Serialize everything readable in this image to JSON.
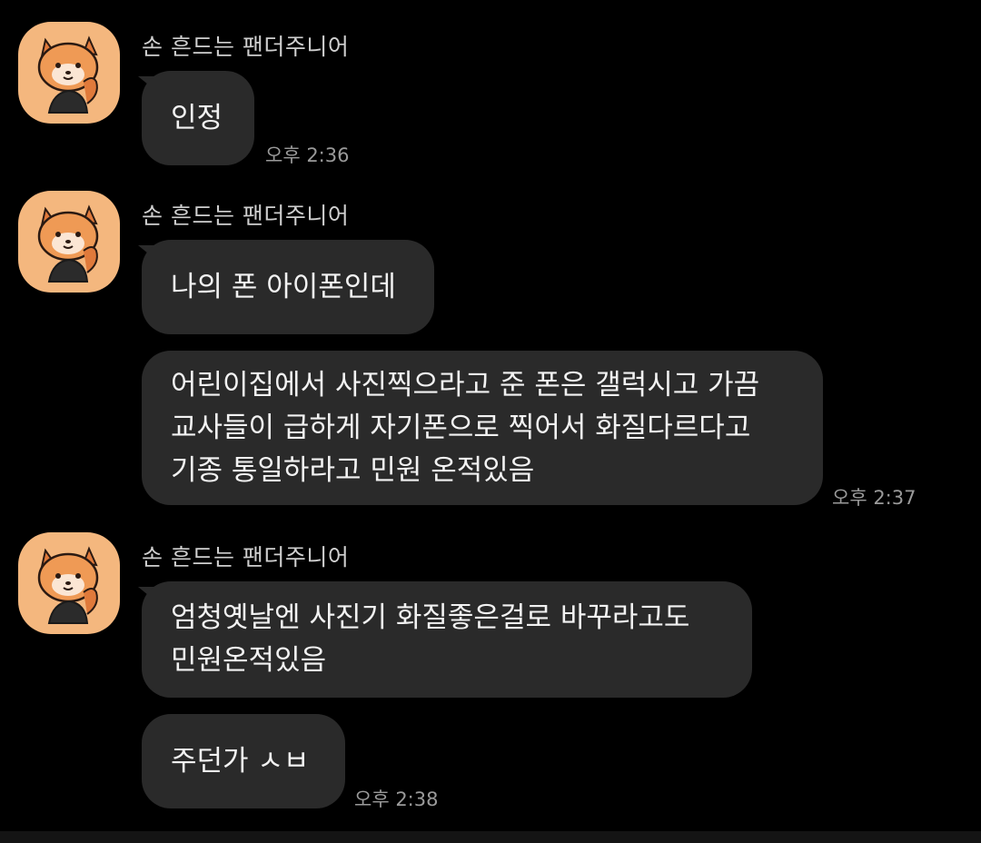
{
  "colors": {
    "background": "#000000",
    "bubble": "#2a2a2a",
    "text": "#f2f2f2",
    "sender": "#cfcfcf",
    "timestamp": "#9a9a9a",
    "avatar_bg": "#f4b77e"
  },
  "groups": [
    {
      "sender": "손 흔드는 팬더주니어",
      "avatar_icon": "red-panda-avatar-icon",
      "messages": [
        {
          "lines": [
            "인정"
          ],
          "time": "오후 2:36"
        }
      ]
    },
    {
      "sender": "손 흔드는 팬더주니어",
      "avatar_icon": "red-panda-avatar-icon",
      "messages": [
        {
          "lines": [
            "나의 폰 아이폰인데"
          ],
          "time": ""
        },
        {
          "lines": [
            "어린이집에서 사진찍으라고 준 폰은 갤럭시고 가끔",
            "교사들이 급하게 자기폰으로 찍어서 화질다르다고",
            "기종 통일하라고 민원 온적있음"
          ],
          "time": "오후 2:37"
        }
      ]
    },
    {
      "sender": "손 흔드는 팬더주니어",
      "avatar_icon": "red-panda-avatar-icon",
      "messages": [
        {
          "lines": [
            "엄청옛날엔 사진기 화질좋은걸로 바꾸라고도",
            "민원온적있음"
          ],
          "time": ""
        },
        {
          "lines": [
            "주던가 ㅅㅂ"
          ],
          "time": "오후 2:38"
        }
      ]
    }
  ]
}
